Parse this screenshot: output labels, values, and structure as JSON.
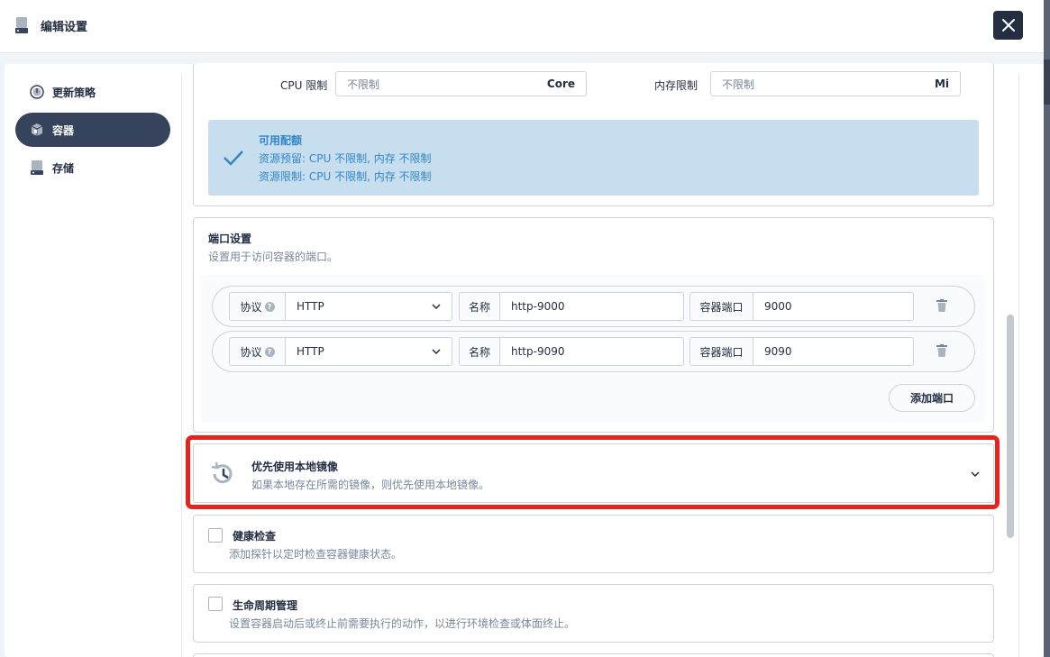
{
  "header": {
    "title": "编辑设置"
  },
  "sidebar": {
    "items": [
      {
        "label": "更新策略",
        "icon": "update-strategy-icon",
        "active": false
      },
      {
        "label": "容器",
        "icon": "container-icon",
        "active": true
      },
      {
        "label": "存储",
        "icon": "storage-icon",
        "active": false
      }
    ]
  },
  "resources": {
    "cpu_label": "CPU 限制",
    "cpu_placeholder": "不限制",
    "cpu_unit": "Core",
    "mem_label": "内存限制",
    "mem_placeholder": "不限制",
    "mem_unit": "Mi"
  },
  "quota": {
    "title": "可用配额",
    "reserve_line": "资源预留:  CPU 不限制, 内存 不限制",
    "limit_line": "资源限制:  CPU 不限制, 内存 不限制"
  },
  "ports": {
    "title": "端口设置",
    "description": "设置用于访问容器的端口。",
    "protocol_label": "协议",
    "name_label": "名称",
    "container_port_label": "容器端口",
    "rows": [
      {
        "protocol": "HTTP",
        "name": "http-9000",
        "port": "9000"
      },
      {
        "protocol": "HTTP",
        "name": "http-9090",
        "port": "9090"
      }
    ],
    "add_button": "添加端口"
  },
  "prefer_local": {
    "title": "优先使用本地镜像",
    "description": "如果本地存在所需的镜像，则优先使用本地镜像。"
  },
  "health_check": {
    "title": "健康检查",
    "description": "添加探针以定时检查容器健康状态。"
  },
  "lifecycle": {
    "title": "生命周期管理",
    "description": "设置容器启动后或终止前需要执行的动作，以进行环境检查或体面终止。"
  },
  "colors": {
    "primary_dark": "#242e42",
    "active_nav": "#36435c",
    "quota_bg": "#c7deef",
    "quota_text": "#3385c6",
    "highlight": "#e6241e"
  }
}
